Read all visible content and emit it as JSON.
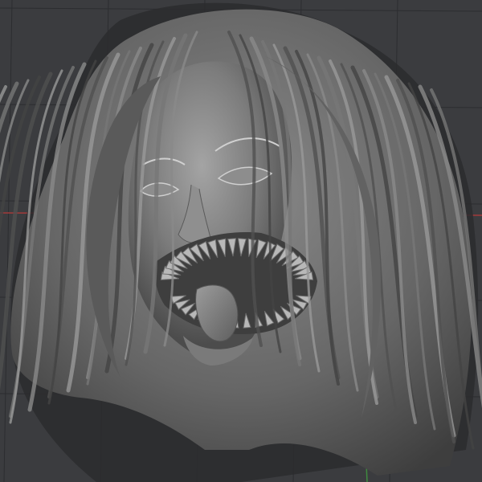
{
  "viewport": {
    "colors": {
      "background": "#3b3c3f",
      "grid_line": "#2c2d30",
      "x_axis": "#a23a3a",
      "y_axis": "#3f8a3f",
      "model_light": "#9a9a9a",
      "model_mid": "#6f6f6f",
      "model_shadow": "#3a3a3a",
      "cast_shadow": "#2a2b2d"
    },
    "model_object": "sculpted-head-icon"
  }
}
